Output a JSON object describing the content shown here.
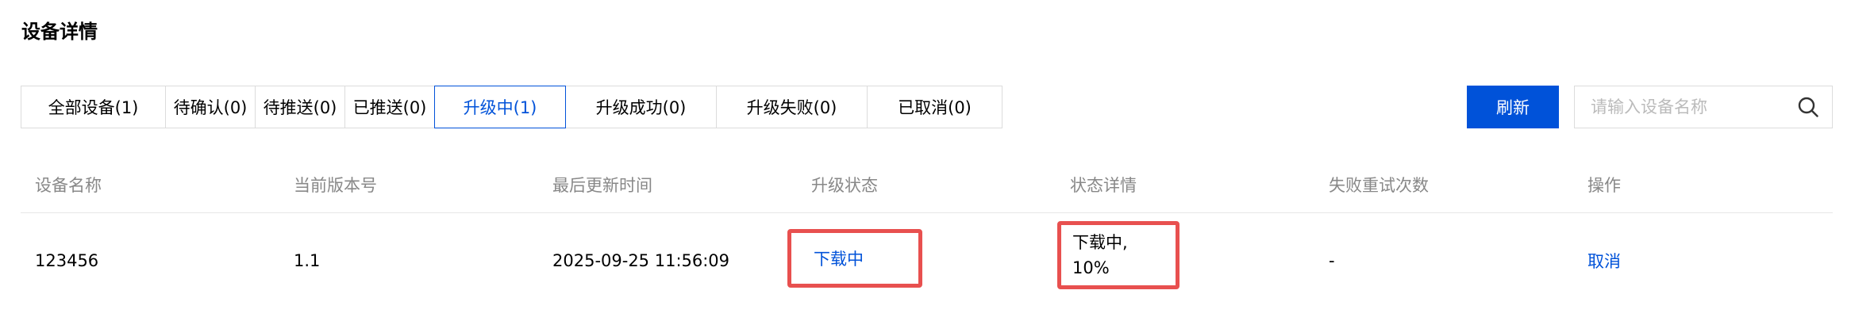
{
  "page": {
    "title": "设备详情"
  },
  "tabs": [
    {
      "label": "全部设备(1)",
      "active": false
    },
    {
      "label": "待确认(0)",
      "active": false
    },
    {
      "label": "待推送(0)",
      "active": false
    },
    {
      "label": "已推送(0)",
      "active": false
    },
    {
      "label": "升级中(1)",
      "active": true
    },
    {
      "label": "升级成功(0)",
      "active": false
    },
    {
      "label": "升级失败(0)",
      "active": false
    },
    {
      "label": "已取消(0)",
      "active": false
    }
  ],
  "toolbar": {
    "refresh_label": "刷新",
    "search_placeholder": "请输入设备名称",
    "search_value": "",
    "search_icon": "search-icon"
  },
  "table": {
    "columns": [
      "设备名称",
      "当前版本号",
      "最后更新时间",
      "升级状态",
      "状态详情",
      "失败重试次数",
      "操作"
    ],
    "rows": [
      {
        "device_name": "123456",
        "version": "1.1",
        "last_updated": "2025-09-25 11:56:09",
        "upgrade_status": "下载中",
        "status_detail_line1": "下载中,",
        "status_detail_line2": "10%",
        "retry_count": "-",
        "action": "取消"
      }
    ]
  },
  "colors": {
    "primary": "#0052d9",
    "highlight_border": "#e8504f",
    "header_text": "#888888",
    "border": "#dcdcdc"
  }
}
